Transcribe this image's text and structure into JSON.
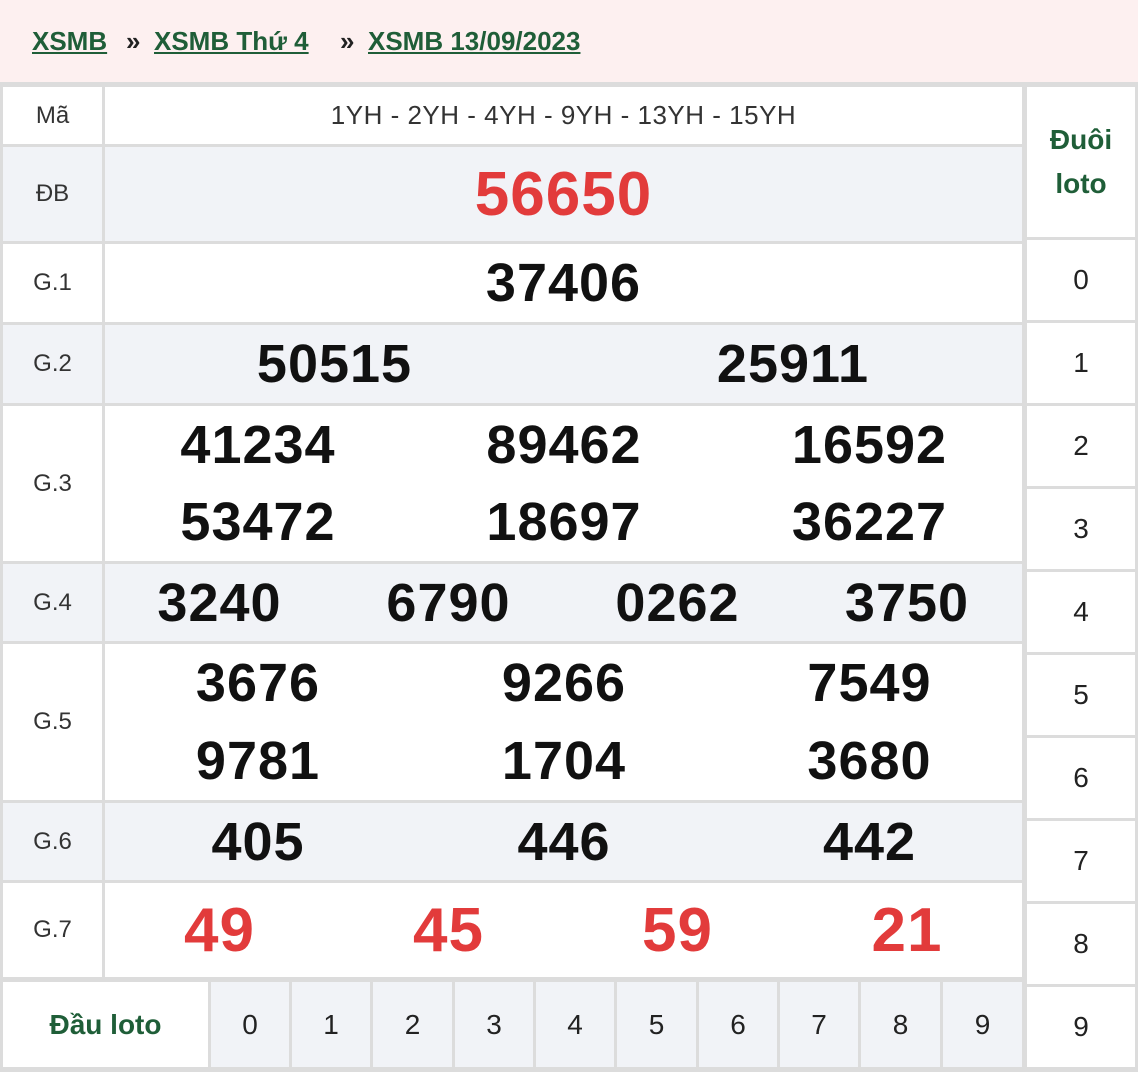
{
  "breadcrumb": {
    "items": [
      "XSMB",
      "XSMB Thứ 4",
      "XSMB 13/09/2023"
    ],
    "separator": "»"
  },
  "table": {
    "ma_label": "Mã",
    "ma_codes": "1YH - 2YH - 4YH - 9YH - 13YH - 15YH",
    "prizes": {
      "db": {
        "label": "ĐB",
        "numbers": [
          "56650"
        ]
      },
      "g1": {
        "label": "G.1",
        "numbers": [
          "37406"
        ]
      },
      "g2": {
        "label": "G.2",
        "numbers": [
          "50515",
          "25911"
        ]
      },
      "g3": {
        "label": "G.3",
        "numbers": [
          "41234",
          "89462",
          "16592",
          "53472",
          "18697",
          "36227"
        ]
      },
      "g4": {
        "label": "G.4",
        "numbers": [
          "3240",
          "6790",
          "0262",
          "3750"
        ]
      },
      "g5": {
        "label": "G.5",
        "numbers": [
          "3676",
          "9266",
          "7549",
          "9781",
          "1704",
          "3680"
        ]
      },
      "g6": {
        "label": "G.6",
        "numbers": [
          "405",
          "446",
          "442"
        ]
      },
      "g7": {
        "label": "G.7",
        "numbers": [
          "49",
          "45",
          "59",
          "21"
        ]
      }
    },
    "dau_loto": {
      "label": "Đầu loto",
      "digits": [
        "0",
        "1",
        "2",
        "3",
        "4",
        "5",
        "6",
        "7",
        "8",
        "9"
      ]
    },
    "duoi_loto": {
      "label_line1": "Đuôi",
      "label_line2": "loto",
      "digits": [
        "0",
        "1",
        "2",
        "3",
        "4",
        "5",
        "6",
        "7",
        "8",
        "9"
      ]
    }
  },
  "colors": {
    "breadcrumb_bg": "#fdf0f0",
    "link_green": "#1f5e38",
    "highlight_red": "#e23b3b",
    "row_gray": "#f1f3f7",
    "border": "#dcdcdc"
  }
}
